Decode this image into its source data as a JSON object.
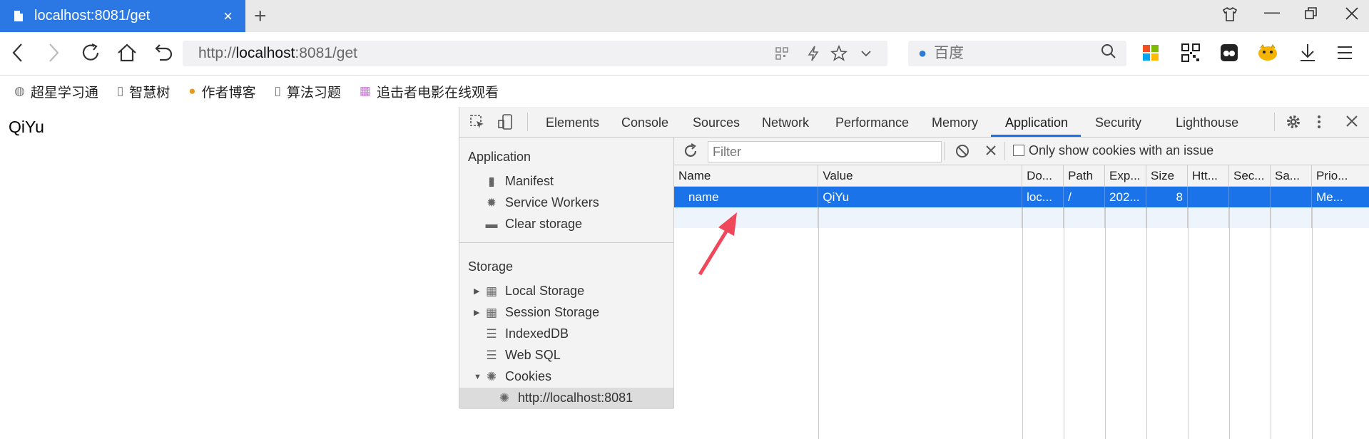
{
  "browser": {
    "tab_title": "localhost:8081/get",
    "tab_close": "×",
    "new_tab": "+",
    "url_prefix": "http://",
    "url_host": "localhost",
    "url_rest": ":8081/get",
    "search_placeholder": "百度",
    "bookmarks": [
      {
        "label": "超星学习通",
        "icon": "globe-icon"
      },
      {
        "label": "智慧树",
        "icon": "document-icon"
      },
      {
        "label": "作者博客",
        "icon": "avatar-icon"
      },
      {
        "label": "算法习题",
        "icon": "document-icon"
      },
      {
        "label": "追击者电影在线观看",
        "icon": "image-icon"
      }
    ]
  },
  "page": {
    "text": "QiYu"
  },
  "devtools": {
    "tabs": [
      "Elements",
      "Console",
      "Sources",
      "Network",
      "Performance",
      "Memory",
      "Application",
      "Security",
      "Lighthouse"
    ],
    "active_tab": "Application",
    "sidebar": {
      "application_header": "Application",
      "application_items": [
        "Manifest",
        "Service Workers",
        "Clear storage"
      ],
      "storage_header": "Storage",
      "storage_items": [
        "Local Storage",
        "Session Storage",
        "IndexedDB",
        "Web SQL",
        "Cookies"
      ],
      "cookie_origin": "http://localhost:8081"
    },
    "toolbar": {
      "filter_placeholder": "Filter",
      "only_issue_label": "Only show cookies with an issue"
    },
    "table": {
      "headers": [
        "Name",
        "Value",
        "Do...",
        "Path",
        "Exp...",
        "Size",
        "Htt...",
        "Sec...",
        "Sa...",
        "Prio..."
      ],
      "rows": [
        [
          "name",
          "QiYu",
          "loc...",
          "/",
          "202...",
          "8",
          "",
          "",
          "",
          "Me..."
        ]
      ]
    }
  },
  "colors": {
    "accent": "#1a73e8",
    "tab": "#2b78e4",
    "annotation_arrow": "#f0475a"
  }
}
